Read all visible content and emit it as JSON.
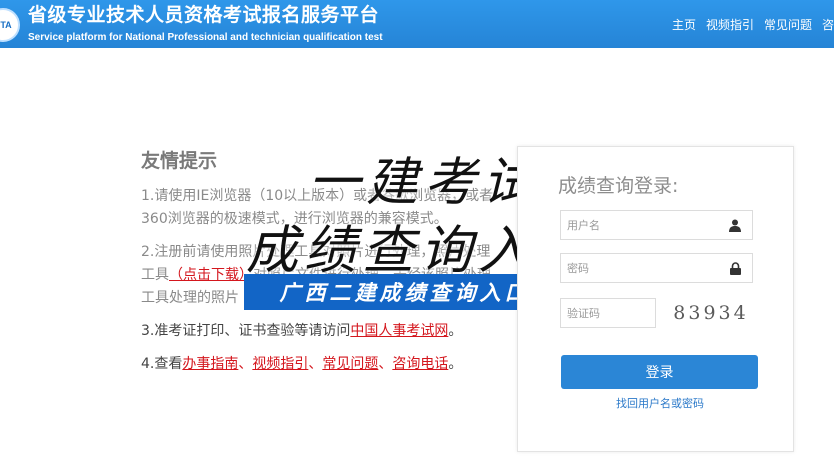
{
  "header": {
    "logo_text": "PTA",
    "title_cn": "省级专业技术人员资格考试报名服务平台",
    "title_en": "Service platform for National Professional and technician qualification test",
    "nav": [
      "主页",
      "视频指引",
      "常见问题",
      "咨询"
    ]
  },
  "notice": {
    "heading": "友情提示",
    "item1": "1.请使用IE浏览器（10以上版本）或者谷歌浏览器，或者360浏览器的极速模式，进行浏览器的兼容模式。",
    "item2_pre": "2.注册前请使用照片处理工具对照片进行处理，照片处理工具",
    "item2_link": "（点击下载）",
    "item2_post": "对照片文件进行处理，未经该照片处理工具处理的照片",
    "item3_pre": "3.准考证打印、证书查验等请访问",
    "item3_link": "中国人事考试网",
    "item3_end": "。",
    "item4_pre": "4.查看",
    "item4_links": [
      "办事指南",
      "视频指引",
      "常见问题",
      "咨询电话"
    ],
    "item4_sep": "、",
    "item4_end": "。"
  },
  "overlay": {
    "line1": "一建考试",
    "line2": "成绩查询入口",
    "banner": "广西二建成绩查询入口"
  },
  "login": {
    "title": "成绩查询登录:",
    "username_placeholder": "用户名",
    "password_placeholder": "密码",
    "captcha_placeholder": "验证码",
    "captcha_code": "83934",
    "button_label": "登录",
    "forgot_label": "找回用户名或密码"
  },
  "colors": {
    "header_bg": "#2a8fe0",
    "link_red": "#d4161d",
    "button_blue": "#2b86d6",
    "banner_blue": "#1265c6"
  },
  "icons": {
    "user": "user-icon",
    "lock": "lock-icon"
  }
}
